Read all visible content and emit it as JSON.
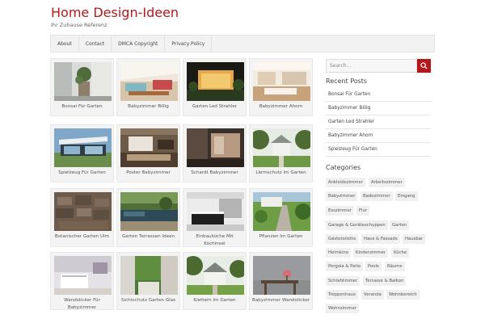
{
  "header": {
    "title": "Home Design-Ideen",
    "tagline": "Ihr Zuhause Referenz"
  },
  "nav": {
    "items": [
      "About",
      "Contact",
      "DMCA Copyright",
      "Privacy Policy"
    ]
  },
  "posts": [
    {
      "title": "Bonsai Für Garten",
      "thumb": "bonsai-interior"
    },
    {
      "title": "Babyzimmer Billig",
      "thumb": "kids-room"
    },
    {
      "title": "Garten Led Strahler",
      "thumb": "led-garden-night"
    },
    {
      "title": "Babyzimmer Ahorn",
      "thumb": "kitchen-bright"
    },
    {
      "title": "Spielzeug Für Garten",
      "thumb": "modern-house"
    },
    {
      "title": "Poster Babyzimmer",
      "thumb": "home-theater"
    },
    {
      "title": "Schardt Babyzimmer",
      "thumb": "dark-room"
    },
    {
      "title": "Lärmschutz Im Garten",
      "thumb": "gazebo"
    },
    {
      "title": "Botanischer Garten Ulm",
      "thumb": "stone-texture"
    },
    {
      "title": "Garten Terrassen Ideen",
      "thumb": "pond-terrace"
    },
    {
      "title": "Einbauküche Mit Kochinsel",
      "thumb": "kitchen-island"
    },
    {
      "title": "Pflanzen Im Garten",
      "thumb": "garden-path"
    },
    {
      "title": "Wandsticker Für Babyzimmer",
      "thumb": "nursery"
    },
    {
      "title": "Sichtschutz Garten Glas",
      "thumb": "courtyard-walls"
    },
    {
      "title": "Klettern Im Garten",
      "thumb": "gazebo-2"
    },
    {
      "title": "Babyzimmer Wandsticker",
      "thumb": "grey-wall-flowers"
    }
  ],
  "sidebar": {
    "search_placeholder": "Search...",
    "recent_title": "Recent Posts",
    "recent_posts": [
      "Bonsai Für Garten",
      "Babyzimmer Billig",
      "Garten Led Strahler",
      "Babyzimmer Ahorn",
      "Spielzeug Für Garten"
    ],
    "categories_title": "Categories",
    "categories": [
      "Ankleidezimmer",
      "Arbeitszimmer",
      "Babyzimmer",
      "Badezimmer",
      "Eingang",
      "Esszimmer",
      "Flur",
      "Garage & Geräteschuppen",
      "Garten",
      "Gästetoilette",
      "Haus & Fassade",
      "Hausbar",
      "Heimkino",
      "Kinderzimmer",
      "Küche",
      "Pergola & Patio",
      "Pools",
      "Räume",
      "Schlafzimmer",
      "Terrasse & Balkon",
      "Treppenhaus",
      "Veranda",
      "Wohnbereich",
      "Wohnzimmer"
    ]
  },
  "colors": {
    "accent": "#b5181b",
    "nav_bg": "#f2f2f2",
    "card_bg": "#f3f3f3"
  }
}
